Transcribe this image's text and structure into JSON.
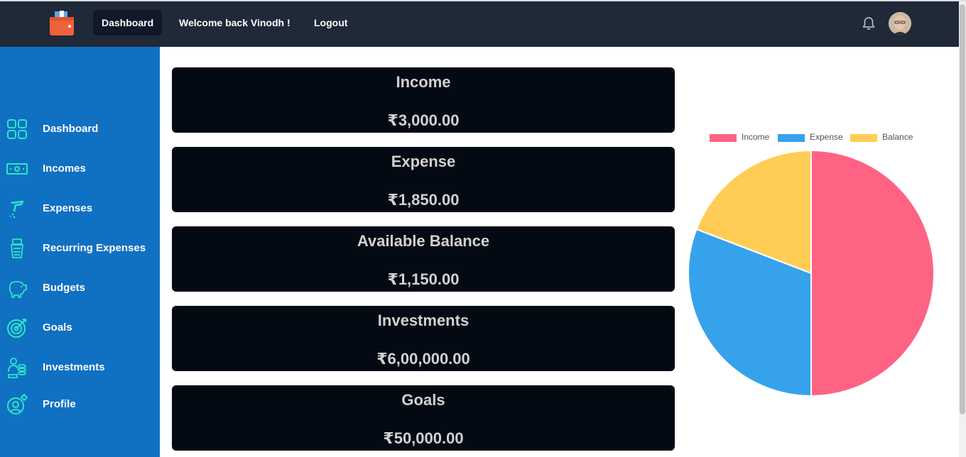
{
  "header": {
    "nav": [
      {
        "label": "Dashboard",
        "active": true
      },
      {
        "label": "Welcome back Vinodh !",
        "active": false
      },
      {
        "label": "Logout",
        "active": false
      }
    ]
  },
  "sidebar": {
    "items": [
      {
        "label": "Dashboard",
        "icon": "grid-icon"
      },
      {
        "label": "Incomes",
        "icon": "money-icon"
      },
      {
        "label": "Expenses",
        "icon": "hand-coin-icon"
      },
      {
        "label": "Recurring Expenses",
        "icon": "cash-stack-icon"
      },
      {
        "label": "Budgets",
        "icon": "piggy-bank-icon"
      },
      {
        "label": "Goals",
        "icon": "target-icon"
      },
      {
        "label": "Investments",
        "icon": "investment-icon"
      },
      {
        "label": "Profile",
        "icon": "profile-gear-icon"
      }
    ]
  },
  "cards": [
    {
      "title": "Income",
      "value": "₹3,000.00"
    },
    {
      "title": "Expense",
      "value": "₹1,850.00"
    },
    {
      "title": "Available Balance",
      "value": "₹1,150.00"
    },
    {
      "title": "Investments",
      "value": "₹6,00,000.00"
    },
    {
      "title": "Goals",
      "value": "₹50,000.00"
    }
  ],
  "colors": {
    "header_bg": "#1f2937",
    "sidebar_bg": "#1070c2",
    "card_bg": "#040a14",
    "icon_accent": "#2ee6c8"
  },
  "chart_data": {
    "type": "pie",
    "categories": [
      "Income",
      "Expense",
      "Balance"
    ],
    "values": [
      3000,
      1850,
      1150
    ],
    "colors": [
      "#ff6384",
      "#36a2eb",
      "#ffcd56"
    ],
    "legend": "top"
  }
}
